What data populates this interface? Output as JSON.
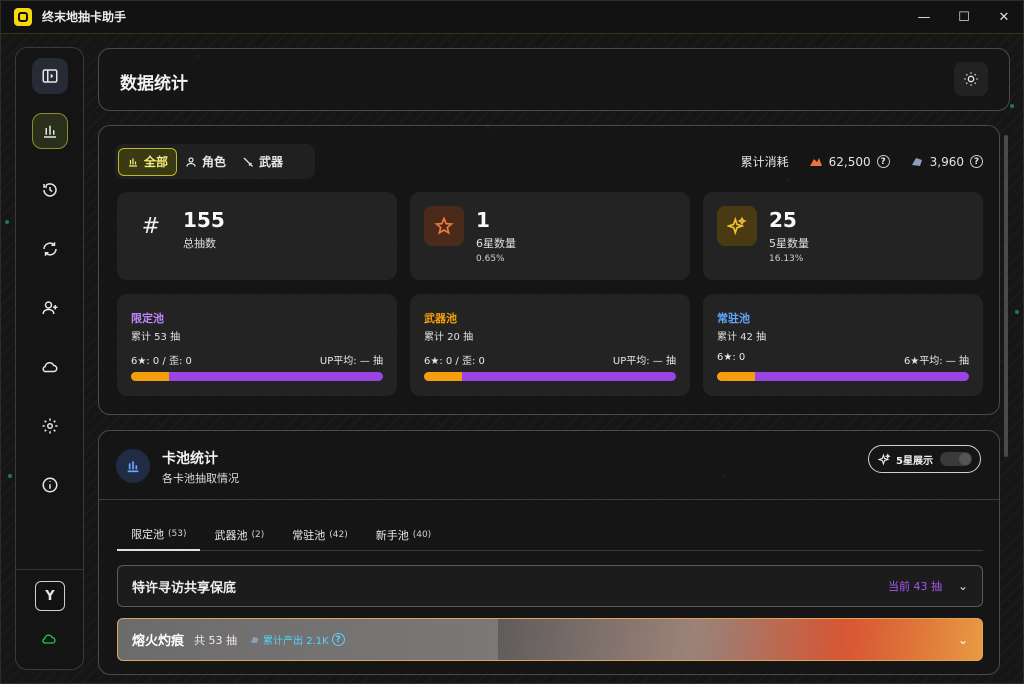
{
  "window": {
    "title": "终末地抽卡助手",
    "minimize": "—",
    "maximize": "☐",
    "close": "✕"
  },
  "sidebar": {
    "items": [
      {
        "icon": "sidebar-toggle-icon"
      },
      {
        "icon": "bar-chart-icon",
        "active": true
      },
      {
        "icon": "history-icon"
      },
      {
        "icon": "sync-icon"
      },
      {
        "icon": "add-user-icon"
      },
      {
        "icon": "cloud-icon"
      },
      {
        "icon": "gear-icon"
      },
      {
        "icon": "info-icon"
      }
    ],
    "avatar_letter": "Y",
    "cloud_status_color": "#22c55e"
  },
  "header": {
    "title": "数据统计"
  },
  "filters": {
    "tabs": [
      "全部",
      "角色",
      "武器"
    ],
    "active": 0
  },
  "cost": {
    "label": "累计消耗",
    "amount1": "62,500",
    "amount2": "3,960"
  },
  "stats": [
    {
      "value": "155",
      "label": "总抽数",
      "sub": ""
    },
    {
      "value": "1",
      "label": "6星数量",
      "sub": "0.65%"
    },
    {
      "value": "25",
      "label": "5星数量",
      "sub": "16.13%"
    }
  ],
  "pools": [
    {
      "name": "限定池",
      "color": "#c084fc",
      "total": "累计 53 抽",
      "left": "6★: 0 / 歪: 0",
      "right": "UP平均: — 抽",
      "fill": 0.15
    },
    {
      "name": "武器池",
      "color": "#f59e0b",
      "total": "累计 20 抽",
      "left": "6★: 0 / 歪: 0",
      "right": "UP平均: — 抽",
      "fill": 0.15
    },
    {
      "name": "常驻池",
      "color": "#60a5fa",
      "total": "累计 42 抽",
      "left": "6★: 0",
      "right": "6★平均: — 抽",
      "fill": 0.15
    }
  ],
  "pool_stats": {
    "title": "卡池统计",
    "subtitle": "各卡池抽取情况",
    "toggle_label": "5星展示",
    "tabs": [
      {
        "label": "限定池",
        "count": "(53)"
      },
      {
        "label": "武器池",
        "count": "(2)"
      },
      {
        "label": "常驻池",
        "count": "(42)"
      },
      {
        "label": "新手池",
        "count": "(40)"
      }
    ],
    "active_tab": 0,
    "rows": [
      {
        "title": "特许寻访共享保底",
        "right": "当前 43 抽"
      }
    ],
    "banner": {
      "title": "熔火灼痕",
      "count": "共 53 抽",
      "production": "累计产出 2.1K"
    }
  }
}
